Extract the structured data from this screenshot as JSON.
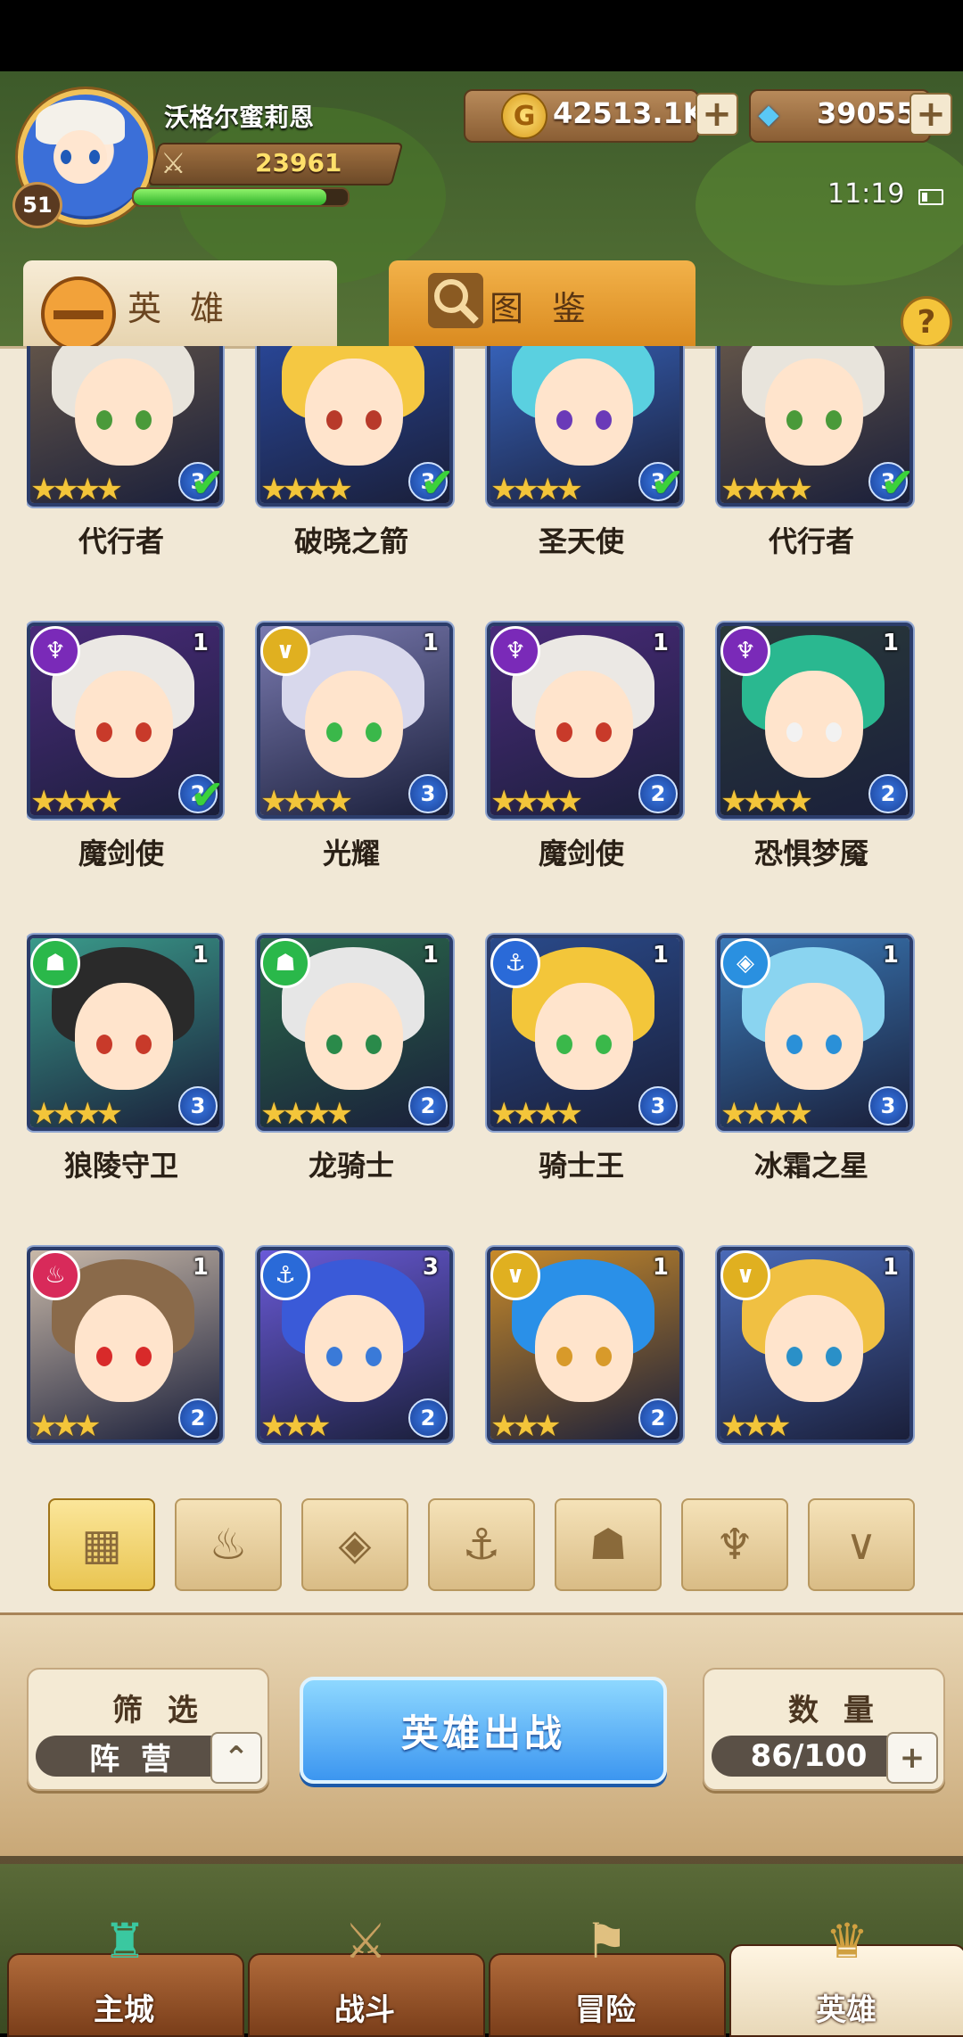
{
  "player": {
    "name": "沃格尔蜜莉恩",
    "level": "51",
    "power": "23961",
    "exp_fraction": 0.9
  },
  "resources": {
    "gold": "42513.1K",
    "gems": "39055",
    "plus": "+"
  },
  "status": {
    "time": "11:19"
  },
  "tabs": [
    {
      "label": "英 雄",
      "active": true
    },
    {
      "label": "图 鉴",
      "active": false
    }
  ],
  "help": "?",
  "heroes": [
    {
      "name": "代行者",
      "count": "",
      "grade": "3",
      "stars": 4,
      "selected": true,
      "faction": "",
      "faction_color": "#e0a020"
    },
    {
      "name": "破晓之箭",
      "count": "",
      "grade": "3",
      "stars": 4,
      "selected": true,
      "faction": "",
      "faction_color": "#e0a020"
    },
    {
      "name": "圣天使",
      "count": "",
      "grade": "3",
      "stars": 4,
      "selected": true,
      "faction": "",
      "faction_color": "#e0a020"
    },
    {
      "name": "代行者",
      "count": "",
      "grade": "3",
      "stars": 4,
      "selected": true,
      "faction": "",
      "faction_color": "#e0a020"
    },
    {
      "name": "魔剑使",
      "count": "1",
      "grade": "2",
      "stars": 4,
      "selected": true,
      "faction": "demon",
      "faction_color": "#7a2ab8"
    },
    {
      "name": "光耀",
      "count": "1",
      "grade": "3",
      "stars": 4,
      "selected": false,
      "faction": "light",
      "faction_color": "#e0b020"
    },
    {
      "name": "魔剑使",
      "count": "1",
      "grade": "2",
      "stars": 4,
      "selected": false,
      "faction": "demon",
      "faction_color": "#7a2ab8"
    },
    {
      "name": "恐惧梦魇",
      "count": "1",
      "grade": "2",
      "stars": 4,
      "selected": false,
      "faction": "demon",
      "faction_color": "#7a2ab8"
    },
    {
      "name": "狼陵守卫",
      "count": "1",
      "grade": "3",
      "stars": 4,
      "selected": false,
      "faction": "beast",
      "faction_color": "#2ab84a"
    },
    {
      "name": "龙骑士",
      "count": "1",
      "grade": "2",
      "stars": 4,
      "selected": false,
      "faction": "beast",
      "faction_color": "#2ab84a"
    },
    {
      "name": "骑士王",
      "count": "1",
      "grade": "3",
      "stars": 4,
      "selected": false,
      "faction": "anchor",
      "faction_color": "#2a6ad8"
    },
    {
      "name": "冰霜之星",
      "count": "1",
      "grade": "3",
      "stars": 4,
      "selected": false,
      "faction": "diamond",
      "faction_color": "#2a90e0"
    },
    {
      "name": "",
      "count": "1",
      "grade": "2",
      "stars": 3,
      "selected": false,
      "faction": "fire",
      "faction_color": "#d82a5a"
    },
    {
      "name": "",
      "count": "3",
      "grade": "2",
      "stars": 3,
      "selected": false,
      "faction": "anchor",
      "faction_color": "#2a6ad8"
    },
    {
      "name": "",
      "count": "1",
      "grade": "2",
      "stars": 3,
      "selected": false,
      "faction": "light",
      "faction_color": "#e0b020"
    },
    {
      "name": "",
      "count": "1",
      "grade": "",
      "stars": 3,
      "selected": false,
      "faction": "light",
      "faction_color": "#e0b020"
    }
  ],
  "filters": [
    {
      "icon": "grid-icon",
      "glyph": "▦",
      "active": true
    },
    {
      "icon": "fire-faction-icon",
      "glyph": "♨",
      "active": false
    },
    {
      "icon": "diamond-faction-icon",
      "glyph": "◈",
      "active": false
    },
    {
      "icon": "anchor-faction-icon",
      "glyph": "⚓",
      "active": false
    },
    {
      "icon": "beast-faction-icon",
      "glyph": "☗",
      "active": false
    },
    {
      "icon": "demon-faction-icon",
      "glyph": "♆",
      "active": false
    },
    {
      "icon": "light-faction-icon",
      "glyph": "∨",
      "active": false
    }
  ],
  "controls": {
    "filter_title": "筛 选",
    "filter_value": "阵 营",
    "deploy_label": "英雄出战",
    "count_title": "数 量",
    "count_value": "86/100"
  },
  "nav": [
    {
      "label": "主城",
      "active": false
    },
    {
      "label": "战斗",
      "active": false
    },
    {
      "label": "冒险",
      "active": false
    },
    {
      "label": "英雄",
      "active": true
    }
  ]
}
